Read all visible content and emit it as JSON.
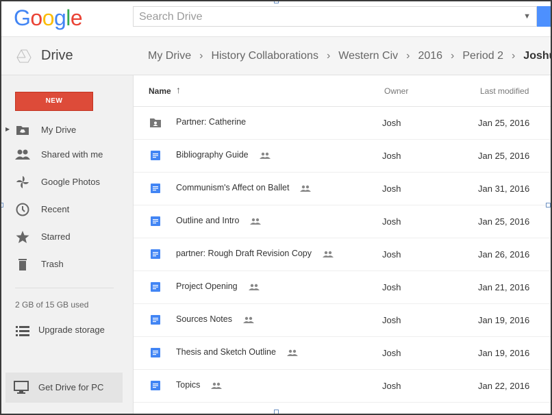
{
  "logo": {
    "letters": [
      "G",
      "o",
      "o",
      "g",
      "l",
      "e"
    ],
    "colors": [
      "#4285f4",
      "#ea4335",
      "#fbbc05",
      "#4285f4",
      "#34a853",
      "#ea4335"
    ]
  },
  "search": {
    "placeholder": "Search Drive",
    "caret": "▼"
  },
  "app": {
    "title": "Drive"
  },
  "breadcrumb": {
    "items": [
      "My Drive",
      "History Collaborations",
      "Western Civ",
      "2016",
      "Period 2",
      "Joshua"
    ],
    "separator": "›"
  },
  "sidebar": {
    "new_label": "NEW",
    "items": [
      {
        "label": "My Drive",
        "icon": "my-drive-icon"
      },
      {
        "label": "Shared with me",
        "icon": "shared-with-me-icon"
      },
      {
        "label": "Google Photos",
        "icon": "google-photos-icon"
      },
      {
        "label": "Recent",
        "icon": "recent-icon"
      },
      {
        "label": "Starred",
        "icon": "star-icon"
      },
      {
        "label": "Trash",
        "icon": "trash-icon"
      }
    ],
    "storage_text": "2 GB of 15 GB used",
    "upgrade_label": "Upgrade storage",
    "get_drive_label": "Get Drive for PC"
  },
  "list": {
    "columns": {
      "name": "Name",
      "sort_arrow": "↑",
      "owner": "Owner",
      "modified": "Last modified"
    },
    "rows": [
      {
        "name": "Partner: Catherine",
        "type": "shared-folder",
        "shared": false,
        "owner": "Josh",
        "modified": "Jan 25, 2016"
      },
      {
        "name": "Bibliography Guide",
        "type": "doc",
        "shared": true,
        "owner": "Josh",
        "modified": "Jan 25, 2016"
      },
      {
        "name": "Communism's Affect on Ballet",
        "type": "doc",
        "shared": true,
        "owner": "Josh",
        "modified": "Jan 31, 2016"
      },
      {
        "name": "Outline and Intro",
        "type": "doc",
        "shared": true,
        "owner": "Josh",
        "modified": "Jan 25, 2016"
      },
      {
        "name": "partner: Rough Draft Revision Copy",
        "type": "doc",
        "shared": true,
        "owner": "Josh",
        "modified": "Jan 26, 2016"
      },
      {
        "name": "Project Opening",
        "type": "doc",
        "shared": true,
        "owner": "Josh",
        "modified": "Jan 21, 2016"
      },
      {
        "name": "Sources Notes",
        "type": "doc",
        "shared": true,
        "owner": "Josh",
        "modified": "Jan 19, 2016"
      },
      {
        "name": "Thesis and Sketch Outline",
        "type": "doc",
        "shared": true,
        "owner": "Josh",
        "modified": "Jan 19, 2016"
      },
      {
        "name": "Topics",
        "type": "doc",
        "shared": true,
        "owner": "Josh",
        "modified": "Jan 22, 2016"
      }
    ]
  },
  "colors": {
    "new_button": "#dd4b39",
    "doc_icon": "#4285f4",
    "search_button": "#4d90fe"
  }
}
